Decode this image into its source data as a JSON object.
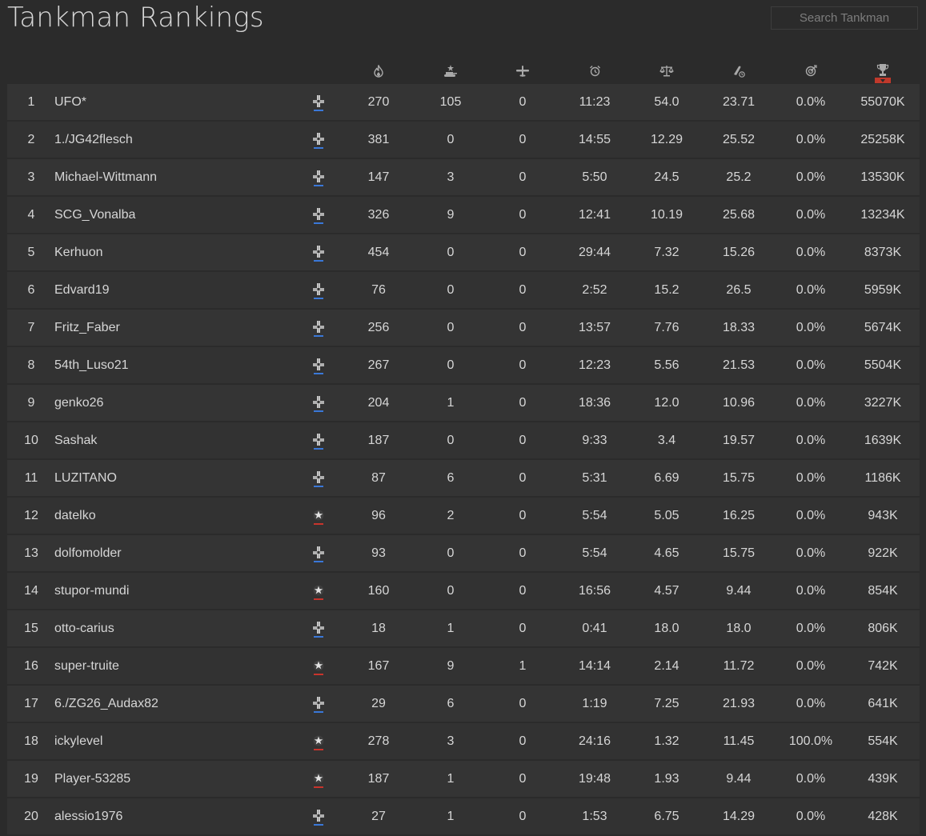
{
  "page": {
    "title": "Tankman Rankings",
    "search_placeholder": "Search Tankman"
  },
  "columns": [
    {
      "key": "kills",
      "icon": "flame-icon"
    },
    {
      "key": "ground_kills",
      "icon": "tank-kill-icon"
    },
    {
      "key": "air_kills",
      "icon": "plane-icon"
    },
    {
      "key": "time",
      "icon": "alarm-clock-icon"
    },
    {
      "key": "kd",
      "icon": "scales-icon"
    },
    {
      "key": "kpm",
      "icon": "shell-icon"
    },
    {
      "key": "accuracy",
      "icon": "target-icon"
    },
    {
      "key": "score",
      "icon": "trophy-icon",
      "sorted": "desc"
    }
  ],
  "colors": {
    "axis_underline": "#3a78d8",
    "allies_underline": "#c8342c",
    "sort_marker": "#c0392b"
  },
  "rows": [
    {
      "rank": "1",
      "name": "UFO*",
      "faction": "axis",
      "kills": "270",
      "ground": "105",
      "air": "0",
      "time": "11:23",
      "kd": "54.0",
      "kpm": "23.71",
      "acc": "0.0%",
      "score": "55070K"
    },
    {
      "rank": "2",
      "name": "1./JG42flesch",
      "faction": "axis",
      "kills": "381",
      "ground": "0",
      "air": "0",
      "time": "14:55",
      "kd": "12.29",
      "kpm": "25.52",
      "acc": "0.0%",
      "score": "25258K"
    },
    {
      "rank": "3",
      "name": "Michael-Wittmann",
      "faction": "axis",
      "kills": "147",
      "ground": "3",
      "air": "0",
      "time": "5:50",
      "kd": "24.5",
      "kpm": "25.2",
      "acc": "0.0%",
      "score": "13530K"
    },
    {
      "rank": "4",
      "name": "SCG_Vonalba",
      "faction": "axis",
      "kills": "326",
      "ground": "9",
      "air": "0",
      "time": "12:41",
      "kd": "10.19",
      "kpm": "25.68",
      "acc": "0.0%",
      "score": "13234K"
    },
    {
      "rank": "5",
      "name": "Kerhuon",
      "faction": "axis",
      "kills": "454",
      "ground": "0",
      "air": "0",
      "time": "29:44",
      "kd": "7.32",
      "kpm": "15.26",
      "acc": "0.0%",
      "score": "8373K"
    },
    {
      "rank": "6",
      "name": "Edvard19",
      "faction": "axis",
      "kills": "76",
      "ground": "0",
      "air": "0",
      "time": "2:52",
      "kd": "15.2",
      "kpm": "26.5",
      "acc": "0.0%",
      "score": "5959K"
    },
    {
      "rank": "7",
      "name": "Fritz_Faber",
      "faction": "axis",
      "kills": "256",
      "ground": "0",
      "air": "0",
      "time": "13:57",
      "kd": "7.76",
      "kpm": "18.33",
      "acc": "0.0%",
      "score": "5674K"
    },
    {
      "rank": "8",
      "name": "54th_Luso21",
      "faction": "axis",
      "kills": "267",
      "ground": "0",
      "air": "0",
      "time": "12:23",
      "kd": "5.56",
      "kpm": "21.53",
      "acc": "0.0%",
      "score": "5504K"
    },
    {
      "rank": "9",
      "name": "genko26",
      "faction": "axis",
      "kills": "204",
      "ground": "1",
      "air": "0",
      "time": "18:36",
      "kd": "12.0",
      "kpm": "10.96",
      "acc": "0.0%",
      "score": "3227K"
    },
    {
      "rank": "10",
      "name": "Sashak",
      "faction": "axis",
      "kills": "187",
      "ground": "0",
      "air": "0",
      "time": "9:33",
      "kd": "3.4",
      "kpm": "19.57",
      "acc": "0.0%",
      "score": "1639K"
    },
    {
      "rank": "11",
      "name": "LUZITANO",
      "faction": "axis",
      "kills": "87",
      "ground": "6",
      "air": "0",
      "time": "5:31",
      "kd": "6.69",
      "kpm": "15.75",
      "acc": "0.0%",
      "score": "1186K"
    },
    {
      "rank": "12",
      "name": "datelko",
      "faction": "allies",
      "kills": "96",
      "ground": "2",
      "air": "0",
      "time": "5:54",
      "kd": "5.05",
      "kpm": "16.25",
      "acc": "0.0%",
      "score": "943K"
    },
    {
      "rank": "13",
      "name": "dolfomolder",
      "faction": "axis",
      "kills": "93",
      "ground": "0",
      "air": "0",
      "time": "5:54",
      "kd": "4.65",
      "kpm": "15.75",
      "acc": "0.0%",
      "score": "922K"
    },
    {
      "rank": "14",
      "name": "stupor-mundi",
      "faction": "allies",
      "kills": "160",
      "ground": "0",
      "air": "0",
      "time": "16:56",
      "kd": "4.57",
      "kpm": "9.44",
      "acc": "0.0%",
      "score": "854K"
    },
    {
      "rank": "15",
      "name": "otto-carius",
      "faction": "axis",
      "kills": "18",
      "ground": "1",
      "air": "0",
      "time": "0:41",
      "kd": "18.0",
      "kpm": "18.0",
      "acc": "0.0%",
      "score": "806K"
    },
    {
      "rank": "16",
      "name": "super-truite",
      "faction": "allies",
      "kills": "167",
      "ground": "9",
      "air": "1",
      "time": "14:14",
      "kd": "2.14",
      "kpm": "11.72",
      "acc": "0.0%",
      "score": "742K"
    },
    {
      "rank": "17",
      "name": "6./ZG26_Audax82",
      "faction": "axis",
      "kills": "29",
      "ground": "6",
      "air": "0",
      "time": "1:19",
      "kd": "7.25",
      "kpm": "21.93",
      "acc": "0.0%",
      "score": "641K"
    },
    {
      "rank": "18",
      "name": "ickylevel",
      "faction": "allies",
      "kills": "278",
      "ground": "3",
      "air": "0",
      "time": "24:16",
      "kd": "1.32",
      "kpm": "11.45",
      "acc": "100.0%",
      "score": "554K"
    },
    {
      "rank": "19",
      "name": "Player-53285",
      "faction": "allies",
      "kills": "187",
      "ground": "1",
      "air": "0",
      "time": "19:48",
      "kd": "1.93",
      "kpm": "9.44",
      "acc": "0.0%",
      "score": "439K"
    },
    {
      "rank": "20",
      "name": "alessio1976",
      "faction": "axis",
      "kills": "27",
      "ground": "1",
      "air": "0",
      "time": "1:53",
      "kd": "6.75",
      "kpm": "14.29",
      "acc": "0.0%",
      "score": "428K"
    }
  ]
}
